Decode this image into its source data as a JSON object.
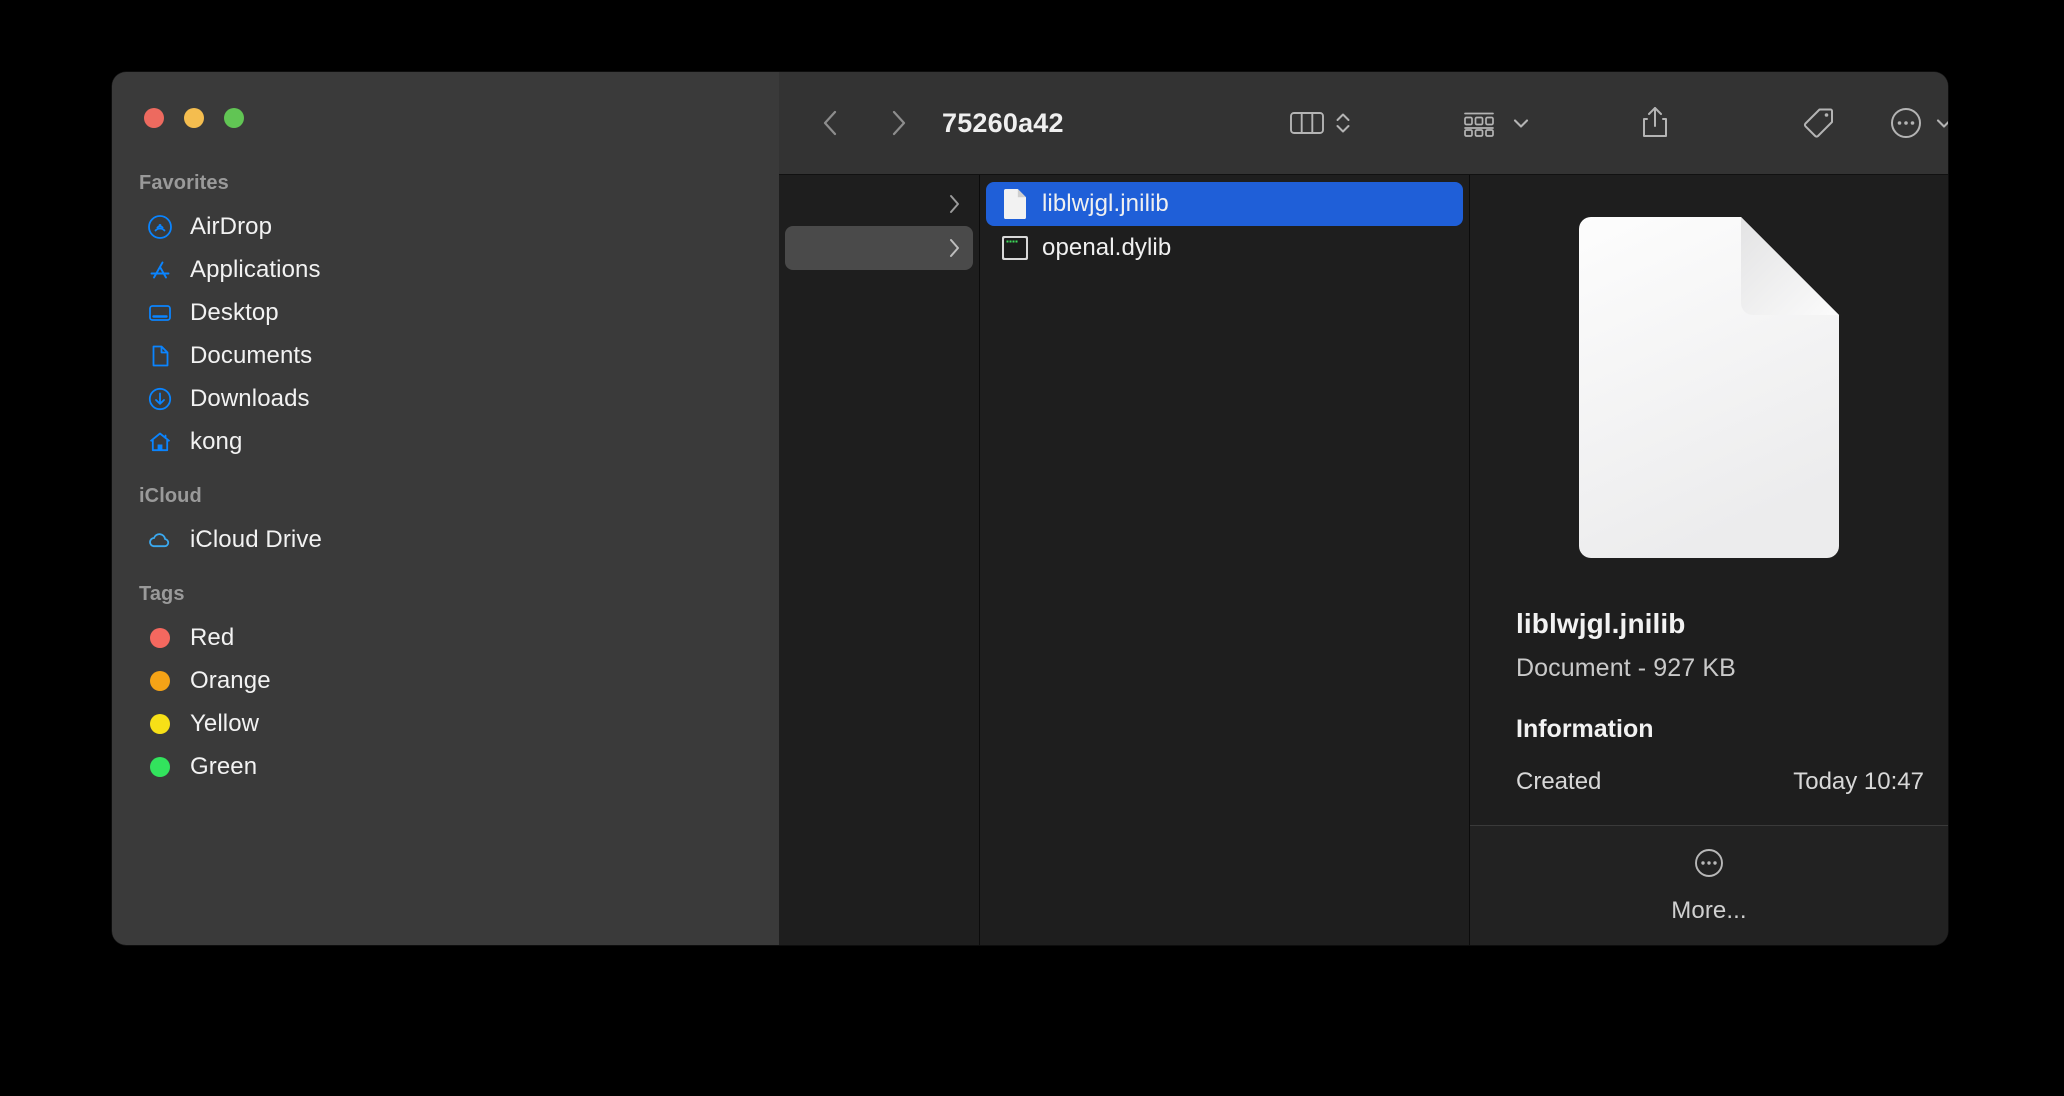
{
  "window": {
    "traffic_lights": [
      {
        "name": "close",
        "color": "#ed6a5f"
      },
      {
        "name": "minimize",
        "color": "#f4bd4f"
      },
      {
        "name": "maximize",
        "color": "#61c554"
      }
    ]
  },
  "toolbar": {
    "title": "75260a42",
    "back_icon": "chevron-left-icon",
    "forward_icon": "chevron-right-icon",
    "view_icon": "column-view-icon",
    "view_stepper_icon": "chevron-up-down-icon",
    "group_icon": "group-by-icon",
    "group_chevron_icon": "chevron-down-icon",
    "share_icon": "share-icon",
    "tag_icon": "tag-icon",
    "more_icon": "ellipsis-circle-icon",
    "more_chevron_icon": "chevron-down-icon",
    "search_icon": "search-icon"
  },
  "sidebar": {
    "groups": [
      {
        "header": "Favorites",
        "items": [
          {
            "label": "AirDrop",
            "icon": "airdrop-icon",
            "color": "#0a84ff"
          },
          {
            "label": "Applications",
            "icon": "applications-icon",
            "color": "#0a84ff"
          },
          {
            "label": "Desktop",
            "icon": "desktop-icon",
            "color": "#0a84ff"
          },
          {
            "label": "Documents",
            "icon": "documents-icon",
            "color": "#0a84ff"
          },
          {
            "label": "Downloads",
            "icon": "downloads-icon",
            "color": "#0a84ff"
          },
          {
            "label": "kong",
            "icon": "home-icon",
            "color": "#0a84ff"
          }
        ]
      },
      {
        "header": "iCloud",
        "items": [
          {
            "label": "iCloud Drive",
            "icon": "cloud-icon",
            "color": "#3aa9f0"
          }
        ]
      },
      {
        "header": "Tags",
        "items": [
          {
            "label": "Red",
            "icon": "tag-dot",
            "color": "#f4685f"
          },
          {
            "label": "Orange",
            "icon": "tag-dot",
            "color": "#f5a316"
          },
          {
            "label": "Yellow",
            "icon": "tag-dot",
            "color": "#f7e017"
          },
          {
            "label": "Green",
            "icon": "tag-dot",
            "color": "#32e35d"
          }
        ]
      }
    ]
  },
  "columns": {
    "parent_rows": [
      {
        "label": "",
        "selected": false,
        "chevron": "chevron-right-icon"
      },
      {
        "label": "",
        "selected": true,
        "chevron": "chevron-right-icon"
      }
    ],
    "files": [
      {
        "label": "liblwjgl.jnilib",
        "icon": "document-file-icon",
        "selected": true
      },
      {
        "label": "openal.dylib",
        "icon": "executable-file-icon",
        "selected": false
      }
    ]
  },
  "preview": {
    "icon": "document-file-icon",
    "filename": "liblwjgl.jnilib",
    "kind_and_size": "Document - 927 KB",
    "info_header": "Information",
    "info_rows": [
      {
        "label": "Created",
        "value": "Today 10:47"
      }
    ],
    "footer": {
      "icon": "ellipsis-circle-icon",
      "label": "More..."
    }
  },
  "colors": {
    "selection_blue": "#1f5fd8",
    "sidebar_bg": "#3a3a3a",
    "content_bg": "#1e1e1e",
    "toolbar_bg": "#333333"
  }
}
